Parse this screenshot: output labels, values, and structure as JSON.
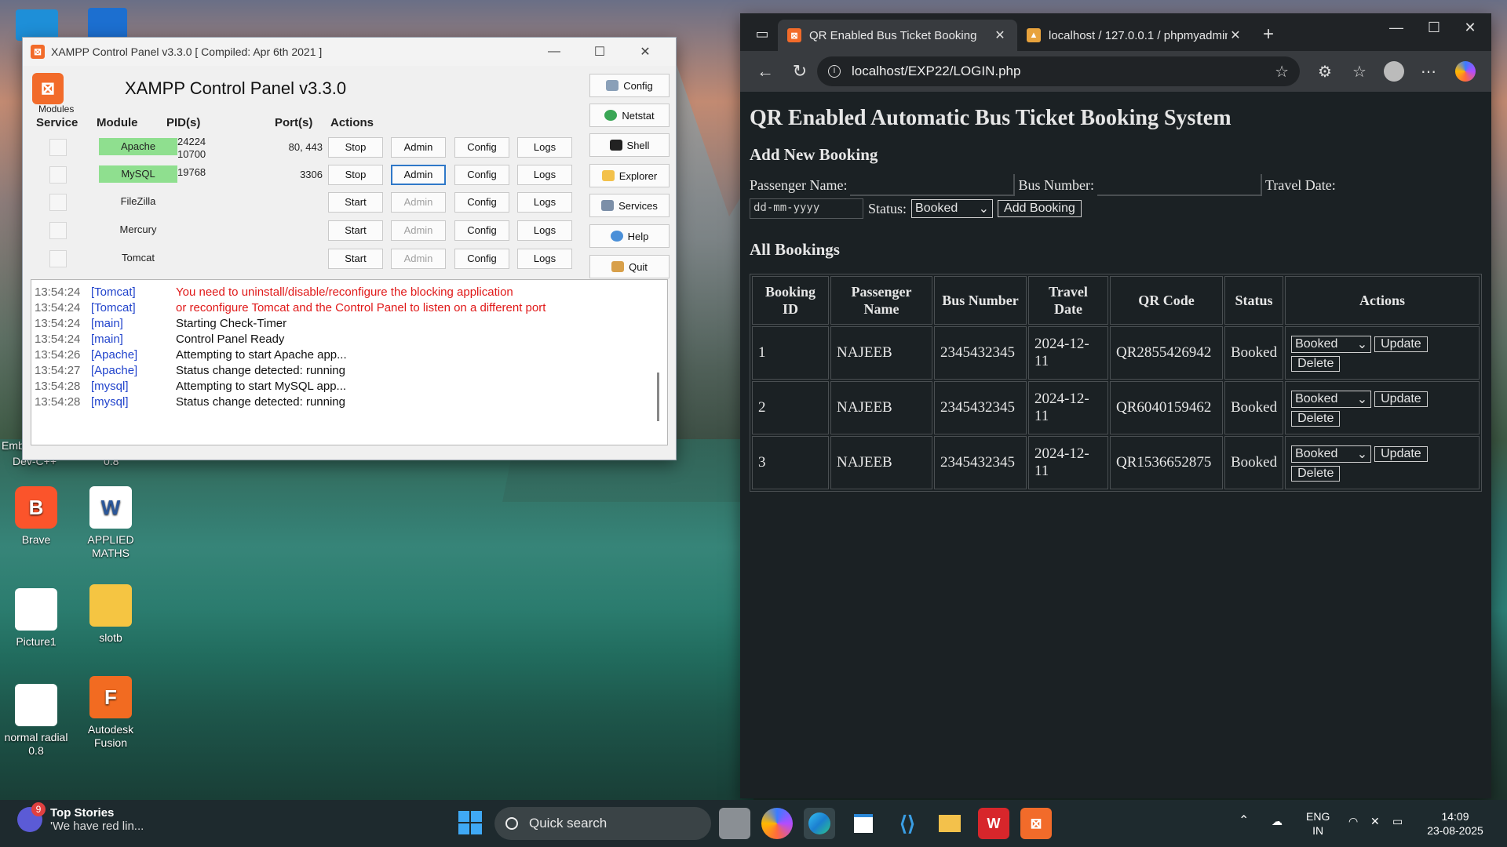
{
  "desktop": {
    "icons": [
      {
        "label": "Brave"
      },
      {
        "label": "APPLIED MATHS"
      },
      {
        "label": "Picture1"
      },
      {
        "label": "slotb"
      },
      {
        "label": "normal radial 0.8"
      },
      {
        "label": "Autodesk Fusion"
      }
    ],
    "partial_labels": [
      "Dev-C++",
      "0.8",
      "Emb"
    ]
  },
  "xampp": {
    "window_title": "XAMPP Control Panel v3.3.0   [ Compiled: Apr 6th 2021 ]",
    "heading": "XAMPP Control Panel v3.3.0",
    "modules_label": "Modules",
    "headers": {
      "service": "Service",
      "module": "Module",
      "pids": "PID(s)",
      "ports": "Port(s)",
      "actions": "Actions"
    },
    "rows": [
      {
        "module": "Apache",
        "pid1": "24224",
        "pid2": "10700",
        "ports": "80, 443",
        "action": "Stop",
        "admin": "Admin",
        "config": "Config",
        "logs": "Logs"
      },
      {
        "module": "MySQL",
        "pid1": "19768",
        "pid2": "",
        "ports": "3306",
        "action": "Stop",
        "admin": "Admin",
        "config": "Config",
        "logs": "Logs"
      },
      {
        "module": "FileZilla",
        "pid1": "",
        "pid2": "",
        "ports": "",
        "action": "Start",
        "admin": "Admin",
        "config": "Config",
        "logs": "Logs"
      },
      {
        "module": "Mercury",
        "pid1": "",
        "pid2": "",
        "ports": "",
        "action": "Start",
        "admin": "Admin",
        "config": "Config",
        "logs": "Logs"
      },
      {
        "module": "Tomcat",
        "pid1": "",
        "pid2": "",
        "ports": "",
        "action": "Start",
        "admin": "Admin",
        "config": "Config",
        "logs": "Logs"
      }
    ],
    "side_buttons": {
      "config": "Config",
      "netstat": "Netstat",
      "shell": "Shell",
      "explorer": "Explorer",
      "services": "Services",
      "help": "Help",
      "quit": "Quit"
    },
    "log": [
      {
        "time": "13:54:24",
        "src": "[Tomcat]",
        "msg": "You need to uninstall/disable/reconfigure the blocking application"
      },
      {
        "time": "13:54:24",
        "src": "[Tomcat]",
        "msg": "or reconfigure Tomcat and the Control Panel to listen on a different port"
      },
      {
        "time": "13:54:24",
        "src": "[main]",
        "msg": "Starting Check-Timer"
      },
      {
        "time": "13:54:24",
        "src": "[main]",
        "msg": "Control Panel Ready"
      },
      {
        "time": "13:54:26",
        "src": "[Apache]",
        "msg": "Attempting to start Apache app..."
      },
      {
        "time": "13:54:27",
        "src": "[Apache]",
        "msg": "Status change detected: running"
      },
      {
        "time": "13:54:28",
        "src": "[mysql]",
        "msg": "Attempting to start MySQL app..."
      },
      {
        "time": "13:54:28",
        "src": "[mysql]",
        "msg": "Status change detected: running"
      }
    ]
  },
  "browser": {
    "tabs": [
      {
        "title": "QR Enabled Bus Ticket Booking"
      },
      {
        "title": "localhost / 127.0.0.1 / phpmyadmin"
      }
    ],
    "url": "localhost/EXP22/LOGIN.php",
    "page": {
      "title": "QR Enabled Automatic Bus Ticket Booking System",
      "add_heading": "Add New Booking",
      "labels": {
        "passenger": "Passenger Name:",
        "bus": "Bus Number:",
        "date": "Travel Date:",
        "status": "Status:"
      },
      "date_placeholder": "dd-mm-yyyy",
      "status_value": "Booked",
      "add_button": "Add Booking",
      "all_heading": "All Bookings",
      "table_headers": [
        "Booking ID",
        "Passenger Name",
        "Bus Number",
        "Travel Date",
        "QR Code",
        "Status",
        "Actions"
      ],
      "rows": [
        {
          "id": "1",
          "name": "NAJEEB",
          "bus": "2345432345",
          "date": "2024-12-11",
          "qr": "QR2855426942",
          "status": "Booked",
          "sel": "Booked",
          "update": "Update",
          "delete": "Delete"
        },
        {
          "id": "2",
          "name": "NAJEEB",
          "bus": "2345432345",
          "date": "2024-12-11",
          "qr": "QR6040159462",
          "status": "Booked",
          "sel": "Booked",
          "update": "Update",
          "delete": "Delete"
        },
        {
          "id": "3",
          "name": "NAJEEB",
          "bus": "2345432345",
          "date": "2024-12-11",
          "qr": "QR1536652875",
          "status": "Booked",
          "sel": "Booked",
          "update": "Update",
          "delete": "Delete"
        }
      ]
    }
  },
  "taskbar": {
    "news_badge": "9",
    "news_title": "Top Stories",
    "news_sub": "'We have red lin...",
    "search": "Quick search",
    "lang1": "ENG",
    "lang2": "IN",
    "time": "14:09",
    "date": "23-08-2025"
  }
}
